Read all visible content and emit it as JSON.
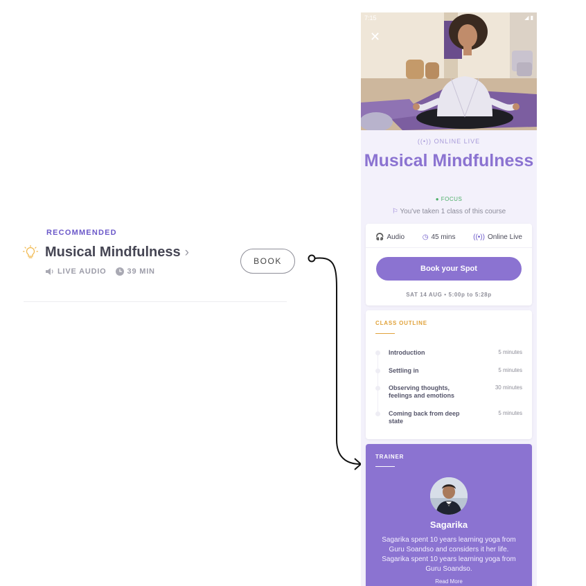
{
  "recommended_card": {
    "section_label": "RECOMMENDED",
    "class_title": "Musical Mindfulness",
    "format_label": "LIVE AUDIO",
    "duration_label": "39 MIN",
    "book_label": "BOOK"
  },
  "detail_screen": {
    "status_time": "7:15",
    "online_label": "ONLINE LIVE",
    "title": "Musical Mindfulness",
    "category_badge": "FOCUS",
    "taken_note": "You've taken 1 class of this course",
    "features": {
      "format": "Audio",
      "duration": "45 mins",
      "mode": "Online Live"
    },
    "book_button_label": "Book your Spot",
    "date_time": "SAT 14 AUG • 5:00p to 5:28p",
    "class_outline": {
      "heading": "CLASS OUTLINE",
      "items": [
        {
          "name": "Introduction",
          "duration": "5 minutes"
        },
        {
          "name": "Settling in",
          "duration": "5 minutes"
        },
        {
          "name": "Observing thoughts, feelings and emotions",
          "duration": "30 minutes"
        },
        {
          "name": "Coming back from deep state",
          "duration": "5 minutes"
        }
      ]
    },
    "trainer": {
      "heading": "TRAINER",
      "name": "Sagarika",
      "bio": "Sagarika spent 10 years learning yoga from Guru Soandso and considers it her life. Sagarika spent 10 years learning yoga from Guru Soandso.",
      "read_more": "Read More"
    }
  },
  "colors": {
    "brand_purple": "#8b73d1",
    "label_purple": "#6b58c9",
    "outline_accent": "#e0a23a",
    "focus_green": "#4caf68"
  },
  "icons": [
    "bulb-icon",
    "chevron-right-icon",
    "speaker-icon",
    "clock-icon",
    "close-icon",
    "broadcast-icon",
    "flag-icon",
    "headphones-icon"
  ]
}
